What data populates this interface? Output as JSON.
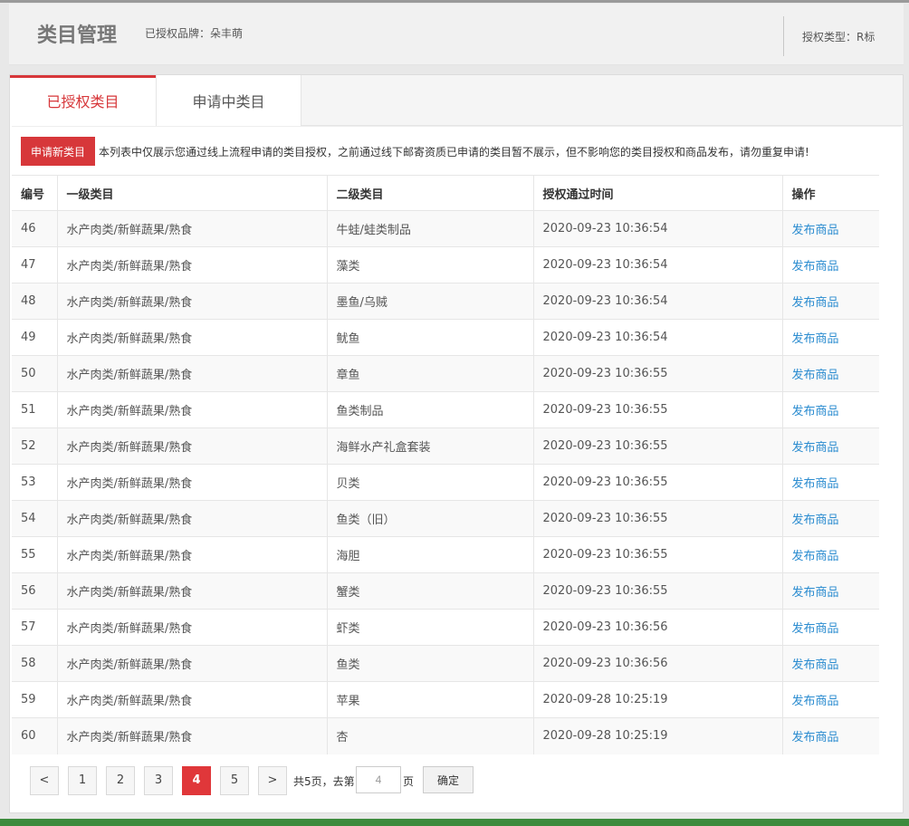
{
  "header": {
    "title": "类目管理",
    "brand": "已授权品牌：朵丰萌",
    "auth_type": "授权类型：R标"
  },
  "tabs": [
    {
      "label": "已授权类目",
      "active": true
    },
    {
      "label": "申请中类目",
      "active": false
    }
  ],
  "notice": {
    "apply_button": "申请新类目",
    "text": "本列表中仅展示您通过线上流程申请的类目授权，之前通过线下邮寄资质已申请的类目暂不展示，但不影响您的类目授权和商品发布，请勿重复申请!"
  },
  "table": {
    "headers": [
      "编号",
      "一级类目",
      "二级类目",
      "授权通过时间",
      "操作"
    ],
    "rows": [
      {
        "id": "46",
        "cat1": "水产肉类/新鲜蔬果/熟食",
        "cat2": "牛蛙/蛙类制品",
        "time": "2020-09-23 10:36:54",
        "action": "发布商品"
      },
      {
        "id": "47",
        "cat1": "水产肉类/新鲜蔬果/熟食",
        "cat2": "藻类",
        "time": "2020-09-23 10:36:54",
        "action": "发布商品"
      },
      {
        "id": "48",
        "cat1": "水产肉类/新鲜蔬果/熟食",
        "cat2": "墨鱼/乌贼",
        "time": "2020-09-23 10:36:54",
        "action": "发布商品"
      },
      {
        "id": "49",
        "cat1": "水产肉类/新鲜蔬果/熟食",
        "cat2": "鱿鱼",
        "time": "2020-09-23 10:36:54",
        "action": "发布商品"
      },
      {
        "id": "50",
        "cat1": "水产肉类/新鲜蔬果/熟食",
        "cat2": "章鱼",
        "time": "2020-09-23 10:36:55",
        "action": "发布商品"
      },
      {
        "id": "51",
        "cat1": "水产肉类/新鲜蔬果/熟食",
        "cat2": "鱼类制品",
        "time": "2020-09-23 10:36:55",
        "action": "发布商品"
      },
      {
        "id": "52",
        "cat1": "水产肉类/新鲜蔬果/熟食",
        "cat2": "海鲜水产礼盒套装",
        "time": "2020-09-23 10:36:55",
        "action": "发布商品"
      },
      {
        "id": "53",
        "cat1": "水产肉类/新鲜蔬果/熟食",
        "cat2": "贝类",
        "time": "2020-09-23 10:36:55",
        "action": "发布商品"
      },
      {
        "id": "54",
        "cat1": "水产肉类/新鲜蔬果/熟食",
        "cat2": "鱼类（旧）",
        "time": "2020-09-23 10:36:55",
        "action": "发布商品"
      },
      {
        "id": "55",
        "cat1": "水产肉类/新鲜蔬果/熟食",
        "cat2": "海胆",
        "time": "2020-09-23 10:36:55",
        "action": "发布商品"
      },
      {
        "id": "56",
        "cat1": "水产肉类/新鲜蔬果/熟食",
        "cat2": "蟹类",
        "time": "2020-09-23 10:36:55",
        "action": "发布商品"
      },
      {
        "id": "57",
        "cat1": "水产肉类/新鲜蔬果/熟食",
        "cat2": "虾类",
        "time": "2020-09-23 10:36:56",
        "action": "发布商品"
      },
      {
        "id": "58",
        "cat1": "水产肉类/新鲜蔬果/熟食",
        "cat2": "鱼类",
        "time": "2020-09-23 10:36:56",
        "action": "发布商品"
      },
      {
        "id": "59",
        "cat1": "水产肉类/新鲜蔬果/熟食",
        "cat2": "苹果",
        "time": "2020-09-28 10:25:19",
        "action": "发布商品"
      },
      {
        "id": "60",
        "cat1": "水产肉类/新鲜蔬果/熟食",
        "cat2": "杏",
        "time": "2020-09-28 10:25:19",
        "action": "发布商品"
      }
    ]
  },
  "pagination": {
    "prev_icon": "chevron-left-icon",
    "next_icon": "chevron-right-icon",
    "prev": "<",
    "next": ">",
    "pages": [
      "1",
      "2",
      "3",
      "4",
      "5"
    ],
    "current": "4",
    "total_text": "共5页，去第",
    "page_suffix": "页",
    "goto_value": "4",
    "confirm": "确定"
  }
}
